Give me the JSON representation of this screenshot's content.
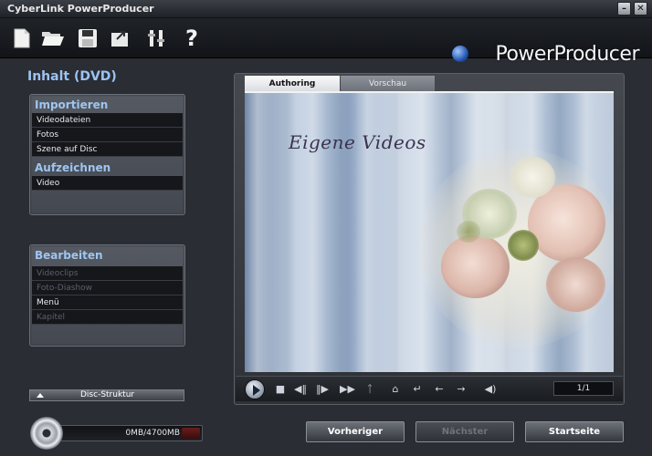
{
  "window": {
    "title": "CyberLink PowerProducer",
    "minimize_glyph": "–",
    "close_glyph": "✕"
  },
  "toolbar": {
    "icons": [
      "new-file-icon",
      "open-folder-icon",
      "save-icon",
      "export-icon",
      "settings-icon",
      "help-icon"
    ],
    "logo_text": "PowerProducer"
  },
  "sidebar": {
    "title": "Inhalt (DVD)",
    "import_head": "Importieren",
    "import_items": [
      "Videodateien",
      "Fotos",
      "Szene auf Disc"
    ],
    "record_head": "Aufzeichnen",
    "record_items": [
      "Video"
    ],
    "edit_head": "Bearbeiten",
    "edit_items": [
      {
        "label": "Videoclips",
        "enabled": false
      },
      {
        "label": "Foto-Diashow",
        "enabled": false
      },
      {
        "label": "Menü",
        "enabled": true
      },
      {
        "label": "Kapitel",
        "enabled": false
      }
    ],
    "disc_structure_label": "Disc-Struktur"
  },
  "tabs": {
    "authoring": "Authoring",
    "preview": "Vorschau"
  },
  "preview": {
    "menu_title": "Eigene Videos"
  },
  "player": {
    "page_counter": "1/1"
  },
  "footer": {
    "capacity_text": "0MB/4700MB",
    "capacity_used_fraction": 0.0,
    "prev_button": "Vorheriger",
    "next_button": "Nächster",
    "home_button": "Startseite"
  },
  "colors": {
    "accent_blue": "#9cc3f2",
    "background": "#2a2d33"
  }
}
